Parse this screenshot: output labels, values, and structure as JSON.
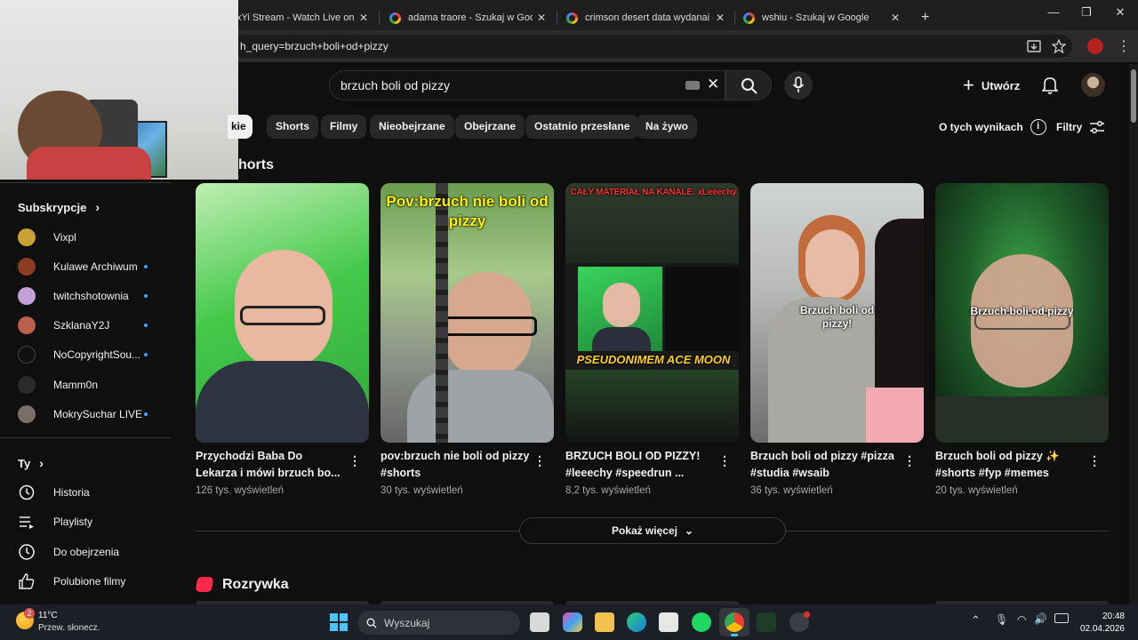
{
  "browser": {
    "tabs": [
      {
        "title": "xYi Stream - Watch Live on Ki"
      },
      {
        "title": "adama traore - Szukaj w Google"
      },
      {
        "title": "crimson desert data wydanai - S"
      },
      {
        "title": "wshiu - Szukaj w Google"
      }
    ],
    "new_tab": "+",
    "close": "✕",
    "url": "h_query=brzuch+boli+od+pizzy"
  },
  "header": {
    "search_value": "brzuch boli od pizzy",
    "create_label": "Utwórz"
  },
  "chips": [
    {
      "label": "kie",
      "active": true
    },
    {
      "label": "Shorts"
    },
    {
      "label": "Filmy"
    },
    {
      "label": "Nieobejrzane"
    },
    {
      "label": "Obejrzane"
    },
    {
      "label": "Ostatnio przesłane"
    },
    {
      "label": "Na żywo"
    }
  ],
  "about_results": "O tych wynikach",
  "filters": "Filtry",
  "shorts_heading": "horts",
  "sidebar": {
    "subs_heading": "Subskrypcje",
    "subs": [
      {
        "name": "Vixpl",
        "dot": false,
        "color": "#c9a233"
      },
      {
        "name": "Kulawe Archiwum",
        "dot": true,
        "color": "#8a3d22"
      },
      {
        "name": "twitchshotownia",
        "dot": true,
        "color": "#c4a0d8"
      },
      {
        "name": "SzklanaY2J",
        "dot": true,
        "color": "#b8604a"
      },
      {
        "name": "NoCopyrightSou...",
        "dot": true,
        "color": "#111111"
      },
      {
        "name": "Mamm0n",
        "dot": false,
        "color": "#2b2b2b"
      },
      {
        "name": "MokrySuchar LIVE",
        "dot": true,
        "color": "#7a6f66"
      }
    ],
    "you_heading": "Ty",
    "you_items": [
      {
        "name": "Historia",
        "icon": "history-icon"
      },
      {
        "name": "Playlisty",
        "icon": "playlist-icon"
      },
      {
        "name": "Do obejrzenia",
        "icon": "clock-icon"
      },
      {
        "name": "Polubione filmy",
        "icon": "thumbs-up-icon"
      }
    ]
  },
  "shorts": [
    {
      "title": "Przychodzi Baba Do Lekarza i mówi brzuch bo...",
      "views": "126 tys. wyświetleń",
      "overlay": ""
    },
    {
      "title": "pov:brzuch nie boli od pizzy #shorts",
      "views": "30 tys. wyświetleń",
      "overlay": "Pov:brzuch nie boli od pizzy"
    },
    {
      "title": "BRZUCH BOLI OD PIZZY! #leeechy #speedrun ...",
      "views": "8,2 tys. wyświetleń",
      "overlay": "CAŁY MATERIAŁ NA KANALE: xLeeechy",
      "overlay2": "PSEUDONIMEM ACE MOON"
    },
    {
      "title": "Brzuch boli od pizzy #pizza #studia #wsaib",
      "views": "36 tys. wyświetleń",
      "overlay": "Brzuch boli od pizzy!"
    },
    {
      "title": "Brzuch boli od pizzy ✨ #shorts #fyp #memes",
      "views": "20 tys. wyświetleń",
      "overlay": "Brzuch boli od pizzy"
    }
  ],
  "show_more": "Pokaż więcej",
  "section2": "Rozrywka",
  "taskbar": {
    "temp": "11°C",
    "weather": "Przew. słonecz.",
    "weather_badge": "2",
    "search_placeholder": "Wyszukaj",
    "time": "20:48",
    "date": "02.04.2026"
  }
}
